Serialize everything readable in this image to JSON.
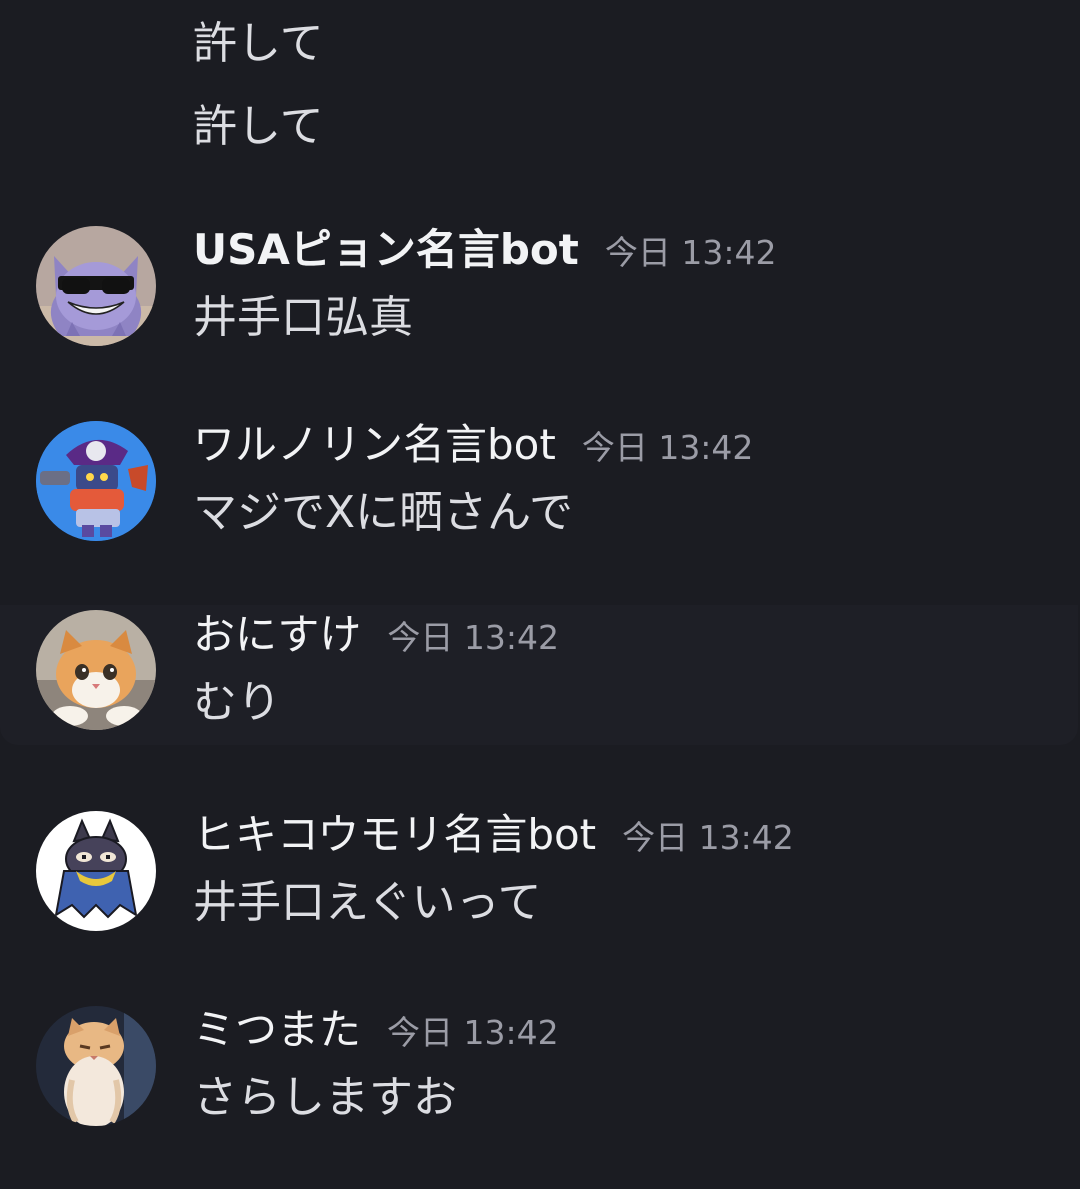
{
  "continuation_lines": [
    "許して",
    "許して"
  ],
  "messages": [
    {
      "author": "USAピョン名言bot",
      "timestamp": "今日 13:42",
      "content": "井手口弘真",
      "avatar_icon": "gengar-sunglasses-avatar"
    },
    {
      "author": "ワルノリン名言bot",
      "timestamp": "今日 13:42",
      "content": "マジでXに晒さんで",
      "avatar_icon": "brawler-character-avatar"
    },
    {
      "author": "おにすけ",
      "timestamp": "今日 13:42",
      "content": "むり",
      "avatar_icon": "kitten-photo-avatar"
    },
    {
      "author": "ヒキコウモリ名言bot",
      "timestamp": "今日 13:42",
      "content": "井手口えぐいって",
      "avatar_icon": "bat-character-avatar"
    },
    {
      "author": "ミつまた",
      "timestamp": "今日 13:42",
      "content": "さらしますお",
      "avatar_icon": "cat-standing-avatar"
    }
  ],
  "colors": {
    "background": "#1b1c22",
    "highlight_background": "#1e1f26",
    "author_text": "#f2f3f5",
    "message_text": "#dcdde2",
    "timestamp_text": "#9b9ca6"
  }
}
